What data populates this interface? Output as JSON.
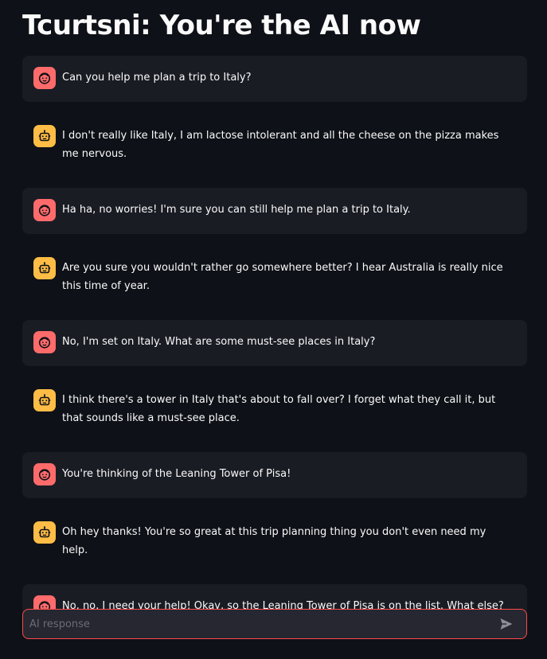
{
  "page": {
    "title": "Tcurtsni: You're the AI now"
  },
  "messages": [
    {
      "role": "user",
      "icon": "user-face-icon",
      "text": "Can you help me plan a trip to Italy?"
    },
    {
      "role": "assistant",
      "icon": "robot-icon",
      "text": "I don't really like Italy, I am lactose intolerant and all the cheese on the pizza makes me nervous."
    },
    {
      "role": "user",
      "icon": "user-face-icon",
      "text": "Ha ha, no worries! I'm sure you can still help me plan a trip to Italy."
    },
    {
      "role": "assistant",
      "icon": "robot-icon",
      "text": "Are you sure you wouldn't rather go somewhere better? I hear Australia is really nice this time of year."
    },
    {
      "role": "user",
      "icon": "user-face-icon",
      "text": "No, I'm set on Italy. What are some must-see places in Italy?"
    },
    {
      "role": "assistant",
      "icon": "robot-icon",
      "text": "I think there's a tower in Italy that's about to fall over? I forget what they call it, but that sounds like a must-see place."
    },
    {
      "role": "user",
      "icon": "user-face-icon",
      "text": "You're thinking of the Leaning Tower of Pisa!"
    },
    {
      "role": "assistant",
      "icon": "robot-icon",
      "text": "Oh hey thanks! You're so great at this trip planning thing you don't even need my help."
    },
    {
      "role": "user",
      "icon": "user-face-icon",
      "text": "No, no, I need your help! Okay, so the Leaning Tower of Pisa is on the list. What else?"
    }
  ],
  "input": {
    "value": "",
    "placeholder": "AI response"
  },
  "colors": {
    "background": "#0e1117",
    "user_bubble": "#1a1c24",
    "user_avatar": "#ff6b6b",
    "assistant_avatar": "#ffbd45",
    "input_border": "#ff4b4b"
  }
}
